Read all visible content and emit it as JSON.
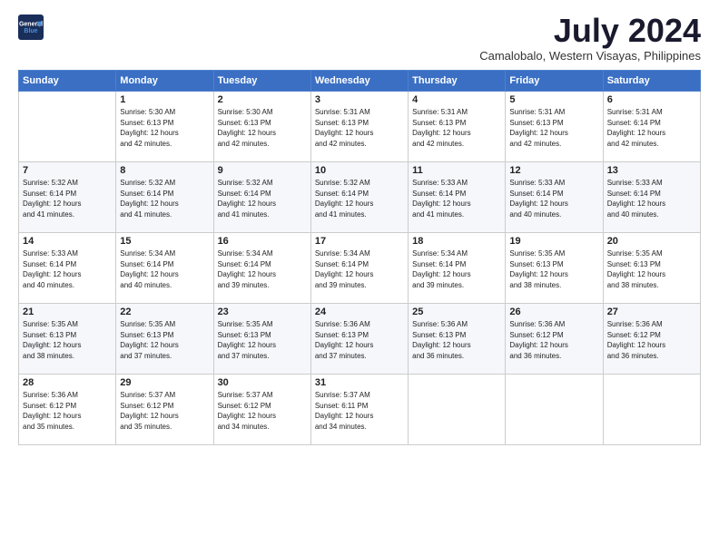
{
  "logo": {
    "line1": "General",
    "line2": "Blue"
  },
  "title": "July 2024",
  "location": "Camalobalo, Western Visayas, Philippines",
  "days_header": [
    "Sunday",
    "Monday",
    "Tuesday",
    "Wednesday",
    "Thursday",
    "Friday",
    "Saturday"
  ],
  "weeks": [
    [
      {
        "num": "",
        "info": ""
      },
      {
        "num": "1",
        "info": "Sunrise: 5:30 AM\nSunset: 6:13 PM\nDaylight: 12 hours\nand 42 minutes."
      },
      {
        "num": "2",
        "info": "Sunrise: 5:30 AM\nSunset: 6:13 PM\nDaylight: 12 hours\nand 42 minutes."
      },
      {
        "num": "3",
        "info": "Sunrise: 5:31 AM\nSunset: 6:13 PM\nDaylight: 12 hours\nand 42 minutes."
      },
      {
        "num": "4",
        "info": "Sunrise: 5:31 AM\nSunset: 6:13 PM\nDaylight: 12 hours\nand 42 minutes."
      },
      {
        "num": "5",
        "info": "Sunrise: 5:31 AM\nSunset: 6:13 PM\nDaylight: 12 hours\nand 42 minutes."
      },
      {
        "num": "6",
        "info": "Sunrise: 5:31 AM\nSunset: 6:14 PM\nDaylight: 12 hours\nand 42 minutes."
      }
    ],
    [
      {
        "num": "7",
        "info": "Sunrise: 5:32 AM\nSunset: 6:14 PM\nDaylight: 12 hours\nand 41 minutes."
      },
      {
        "num": "8",
        "info": "Sunrise: 5:32 AM\nSunset: 6:14 PM\nDaylight: 12 hours\nand 41 minutes."
      },
      {
        "num": "9",
        "info": "Sunrise: 5:32 AM\nSunset: 6:14 PM\nDaylight: 12 hours\nand 41 minutes."
      },
      {
        "num": "10",
        "info": "Sunrise: 5:32 AM\nSunset: 6:14 PM\nDaylight: 12 hours\nand 41 minutes."
      },
      {
        "num": "11",
        "info": "Sunrise: 5:33 AM\nSunset: 6:14 PM\nDaylight: 12 hours\nand 41 minutes."
      },
      {
        "num": "12",
        "info": "Sunrise: 5:33 AM\nSunset: 6:14 PM\nDaylight: 12 hours\nand 40 minutes."
      },
      {
        "num": "13",
        "info": "Sunrise: 5:33 AM\nSunset: 6:14 PM\nDaylight: 12 hours\nand 40 minutes."
      }
    ],
    [
      {
        "num": "14",
        "info": "Sunrise: 5:33 AM\nSunset: 6:14 PM\nDaylight: 12 hours\nand 40 minutes."
      },
      {
        "num": "15",
        "info": "Sunrise: 5:34 AM\nSunset: 6:14 PM\nDaylight: 12 hours\nand 40 minutes."
      },
      {
        "num": "16",
        "info": "Sunrise: 5:34 AM\nSunset: 6:14 PM\nDaylight: 12 hours\nand 39 minutes."
      },
      {
        "num": "17",
        "info": "Sunrise: 5:34 AM\nSunset: 6:14 PM\nDaylight: 12 hours\nand 39 minutes."
      },
      {
        "num": "18",
        "info": "Sunrise: 5:34 AM\nSunset: 6:14 PM\nDaylight: 12 hours\nand 39 minutes."
      },
      {
        "num": "19",
        "info": "Sunrise: 5:35 AM\nSunset: 6:13 PM\nDaylight: 12 hours\nand 38 minutes."
      },
      {
        "num": "20",
        "info": "Sunrise: 5:35 AM\nSunset: 6:13 PM\nDaylight: 12 hours\nand 38 minutes."
      }
    ],
    [
      {
        "num": "21",
        "info": "Sunrise: 5:35 AM\nSunset: 6:13 PM\nDaylight: 12 hours\nand 38 minutes."
      },
      {
        "num": "22",
        "info": "Sunrise: 5:35 AM\nSunset: 6:13 PM\nDaylight: 12 hours\nand 37 minutes."
      },
      {
        "num": "23",
        "info": "Sunrise: 5:35 AM\nSunset: 6:13 PM\nDaylight: 12 hours\nand 37 minutes."
      },
      {
        "num": "24",
        "info": "Sunrise: 5:36 AM\nSunset: 6:13 PM\nDaylight: 12 hours\nand 37 minutes."
      },
      {
        "num": "25",
        "info": "Sunrise: 5:36 AM\nSunset: 6:13 PM\nDaylight: 12 hours\nand 36 minutes."
      },
      {
        "num": "26",
        "info": "Sunrise: 5:36 AM\nSunset: 6:12 PM\nDaylight: 12 hours\nand 36 minutes."
      },
      {
        "num": "27",
        "info": "Sunrise: 5:36 AM\nSunset: 6:12 PM\nDaylight: 12 hours\nand 36 minutes."
      }
    ],
    [
      {
        "num": "28",
        "info": "Sunrise: 5:36 AM\nSunset: 6:12 PM\nDaylight: 12 hours\nand 35 minutes."
      },
      {
        "num": "29",
        "info": "Sunrise: 5:37 AM\nSunset: 6:12 PM\nDaylight: 12 hours\nand 35 minutes."
      },
      {
        "num": "30",
        "info": "Sunrise: 5:37 AM\nSunset: 6:12 PM\nDaylight: 12 hours\nand 34 minutes."
      },
      {
        "num": "31",
        "info": "Sunrise: 5:37 AM\nSunset: 6:11 PM\nDaylight: 12 hours\nand 34 minutes."
      },
      {
        "num": "",
        "info": ""
      },
      {
        "num": "",
        "info": ""
      },
      {
        "num": "",
        "info": ""
      }
    ]
  ]
}
